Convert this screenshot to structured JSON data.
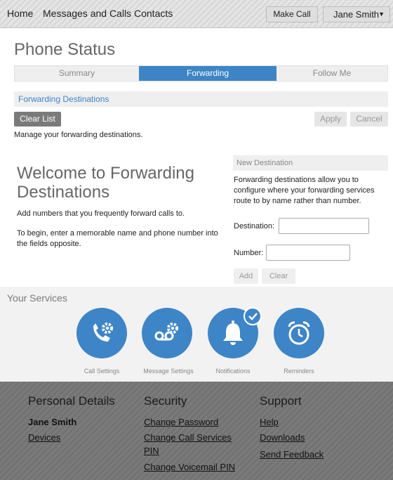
{
  "nav": {
    "home": "Home",
    "messages": "Messages and Calls",
    "contacts": "Contacts",
    "make_call": "Make Call",
    "user_name": "Jane Smith",
    "user_caret": "▼"
  },
  "page": {
    "title": "Phone Status"
  },
  "tabs": [
    {
      "label": "Summary",
      "active": false
    },
    {
      "label": "Forwarding",
      "active": true
    },
    {
      "label": "Follow Me",
      "active": false
    }
  ],
  "forwarding": {
    "section_title": "Forwarding Destinations",
    "clear_list": "Clear List",
    "apply": "Apply",
    "cancel": "Cancel",
    "manage_text": "Manage your forwarding destinations.",
    "welcome_title": "Welcome to Forwarding Destinations",
    "welcome_p1": "Add numbers that you frequently forward calls to.",
    "welcome_p2": "To begin, enter a memorable name and phone number into the fields opposite."
  },
  "new_destination": {
    "title": "New Destination",
    "description": "Forwarding destinations allow you to configure where your forwarding services route to by name rather than number.",
    "destination_label": "Destination:",
    "destination_value": "",
    "number_label": "Number:",
    "number_value": "",
    "add": "Add",
    "clear": "Clear"
  },
  "services": {
    "title": "Your Services",
    "items": [
      {
        "label": "Call Settings",
        "icon": "call-settings-icon"
      },
      {
        "label": "Message Settings",
        "icon": "message-settings-icon"
      },
      {
        "label": "Notifications",
        "icon": "bell-icon",
        "checked": true
      },
      {
        "label": "Reminders",
        "icon": "alarm-clock-icon"
      }
    ]
  },
  "footer": {
    "personal": {
      "heading": "Personal Details",
      "name": "Jane Smith",
      "devices": "Devices"
    },
    "security": {
      "heading": "Security",
      "change_password": "Change Password",
      "change_call_services_pin_1": "Change Call Services",
      "change_call_services_pin_2": "PIN",
      "change_voicemail_pin": "Change Voicemail PIN"
    },
    "support": {
      "heading": "Support",
      "help": "Help",
      "downloads": "Downloads",
      "send_feedback": "Send Feedback"
    }
  },
  "colors": {
    "accent": "#3d85c6",
    "topbar": "#dedede",
    "footer": "#777777"
  }
}
